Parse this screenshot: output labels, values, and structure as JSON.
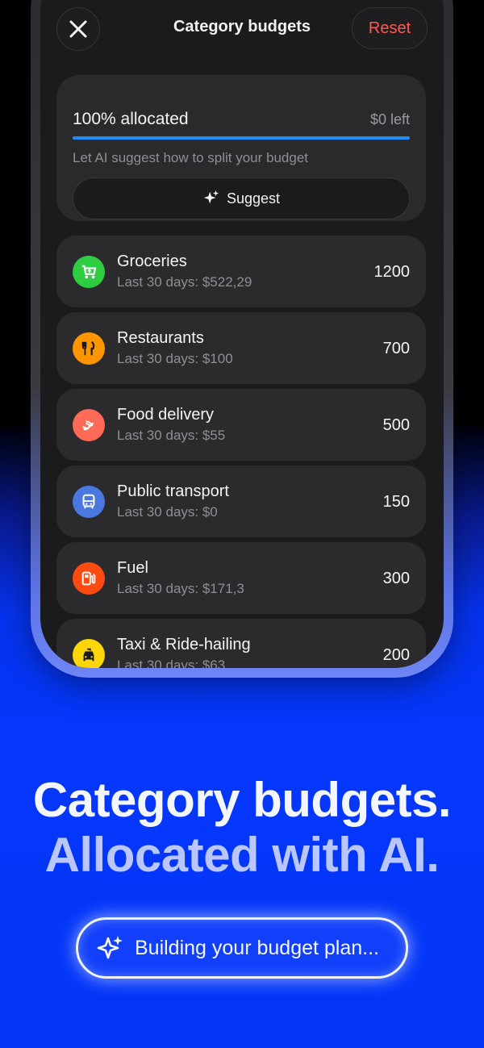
{
  "header": {
    "title": "Category budgets",
    "reset_label": "Reset"
  },
  "allocation": {
    "percent_label": "100% allocated",
    "left_label": "$0 left",
    "progress_fraction": 1.0,
    "hint": "Let AI suggest how to split your budget",
    "suggest_label": "Suggest"
  },
  "categories": [
    {
      "name": "Groceries",
      "sub": "Last 30 days: $522,29",
      "amount": "1200",
      "icon": "cart-icon",
      "color": "#2ecc40"
    },
    {
      "name": "Restaurants",
      "sub": "Last 30 days: $100",
      "amount": "700",
      "icon": "fork-knife-icon",
      "color": "#ff9500"
    },
    {
      "name": "Food delivery",
      "sub": "Last 30 days: $55",
      "amount": "500",
      "icon": "delivery-icon",
      "color": "#ff6b57"
    },
    {
      "name": "Public transport",
      "sub": "Last 30 days: $0",
      "amount": "150",
      "icon": "bus-icon",
      "color": "#4a78e0"
    },
    {
      "name": "Fuel",
      "sub": "Last 30 days: $171,3",
      "amount": "300",
      "icon": "fuel-icon",
      "color": "#ff4a12"
    },
    {
      "name": "Taxi & Ride-hailing",
      "sub": "Last 30 days: $63",
      "amount": "200",
      "icon": "taxi-icon",
      "color": "#ffd60a"
    }
  ],
  "marketing": {
    "line1": "Category budgets.",
    "line2": "Allocated with AI.",
    "pill_label": "Building your budget plan..."
  },
  "colors": {
    "accent_blue": "#1e8cff",
    "reset_red": "#ff5a4e",
    "background_blue": "#0437fa"
  }
}
